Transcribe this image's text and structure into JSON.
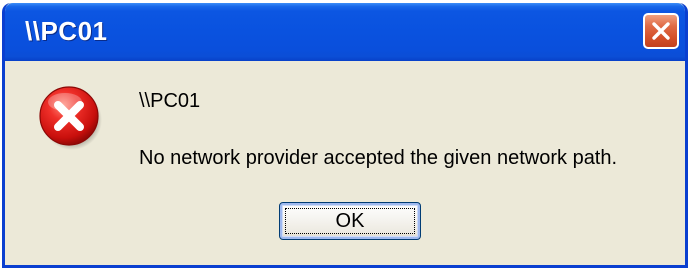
{
  "dialog": {
    "title": "\\\\PC01",
    "path_text": "\\\\PC01",
    "message": "No network provider accepted the given network path.",
    "ok_label": "OK",
    "icon": "error-icon",
    "close_icon": "close-icon"
  },
  "colors": {
    "titlebar": "#0a52df",
    "window_background": "#ece9d8",
    "close_button": "#d4502a",
    "error_red": "#e0201f"
  }
}
